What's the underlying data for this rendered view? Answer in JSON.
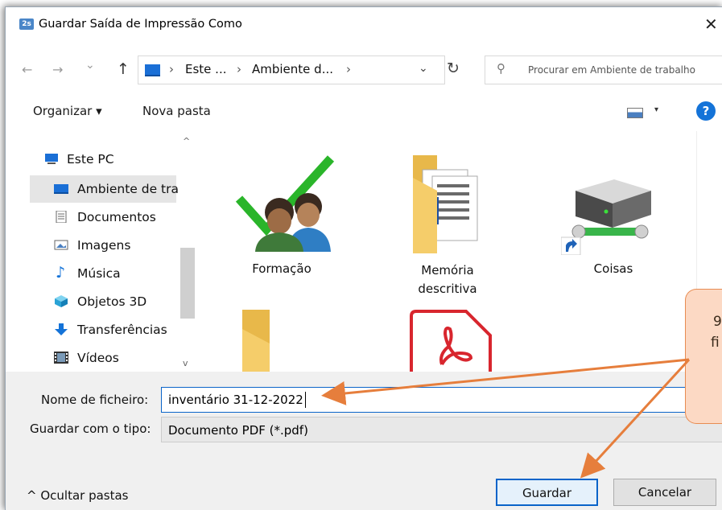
{
  "window": {
    "title": "Guardar Saída de Impressão Como",
    "app_icon_text": "2s",
    "close_glyph": "✕"
  },
  "nav": {
    "back_glyph": "←",
    "forward_glyph": "→",
    "recent_glyph": "⌄",
    "up_glyph": "↑",
    "crumbs": [
      "Este ...",
      "Ambiente d..."
    ],
    "crumb_sep": "›",
    "address_chevron": "⌄",
    "refresh_glyph": "↻",
    "search_placeholder": "Procurar em Ambiente de trabalho"
  },
  "toolbar": {
    "organize_label": "Organizar ▾",
    "new_folder_label": "Nova pasta",
    "view_chevron": "▾",
    "help_label": "?"
  },
  "sidebar": {
    "items": [
      {
        "label": "Este PC",
        "icon": "computer-icon"
      },
      {
        "label": "Ambiente de tra",
        "icon": "desktop-icon",
        "selected": true
      },
      {
        "label": "Documentos",
        "icon": "document-icon"
      },
      {
        "label": "Imagens",
        "icon": "image-icon"
      },
      {
        "label": "Música",
        "icon": "music-note-icon"
      },
      {
        "label": "Objetos 3D",
        "icon": "cube-icon"
      },
      {
        "label": "Transferências",
        "icon": "download-icon"
      },
      {
        "label": "Vídeos",
        "icon": "film-icon"
      }
    ]
  },
  "files": [
    {
      "label": "Formação",
      "icon": "users-check-icon"
    },
    {
      "label": "Memória descritiva",
      "label_line1": "Memória",
      "label_line2": "descritiva",
      "icon": "folder-documents-icon"
    },
    {
      "label": "Coisas",
      "icon": "network-drive-shortcut-icon"
    },
    {
      "label": "",
      "icon": "folder-icon"
    },
    {
      "label": "",
      "icon": "pdf-icon"
    }
  ],
  "form": {
    "filename_label": "Nome de ficheiro:",
    "filename_value": "inventário 31-12-2022",
    "type_label": "Guardar com o tipo:",
    "type_value": "Documento PDF (*.pdf)",
    "hide_folders_label": "^  Ocultar pastas",
    "save_label": "Guardar",
    "cancel_label": "Cancelar"
  },
  "callout": {
    "line1": "9",
    "line2": "fi"
  },
  "colors": {
    "accent": "#0a64c9",
    "callout_fill": "#fcd9c4",
    "callout_border": "#e88c52",
    "arrow": "#e67e3c"
  }
}
